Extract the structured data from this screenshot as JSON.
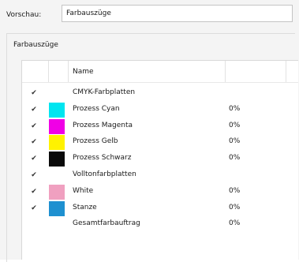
{
  "preview": {
    "label": "Vorschau:",
    "selected": "Farbauszüge"
  },
  "group": {
    "title": "Farbauszüge"
  },
  "table": {
    "header_name": "Name",
    "rows": [
      {
        "checked": true,
        "swatch": null,
        "name": "CMYK-Farbplatten",
        "value": ""
      },
      {
        "checked": true,
        "swatch": "#00e5f0",
        "name": "Prozess Cyan",
        "value": "0%"
      },
      {
        "checked": true,
        "swatch": "#f000e6",
        "name": "Prozess Magenta",
        "value": "0%"
      },
      {
        "checked": true,
        "swatch": "#fff200",
        "name": "Prozess Gelb",
        "value": "0%"
      },
      {
        "checked": true,
        "swatch": "#0a0a0a",
        "name": "Prozess Schwarz",
        "value": "0%"
      },
      {
        "checked": true,
        "swatch": null,
        "name": "Volltonfarbplatten",
        "value": ""
      },
      {
        "checked": true,
        "swatch": "#f0a0c0",
        "name": "White",
        "value": "0%"
      },
      {
        "checked": true,
        "swatch": "#1e90d0",
        "name": "Stanze",
        "value": "0%"
      },
      {
        "checked": false,
        "swatch": null,
        "name": "Gesamtfarbauftrag",
        "value": "0%"
      }
    ]
  },
  "icons": {
    "check": "checkmark-icon"
  }
}
